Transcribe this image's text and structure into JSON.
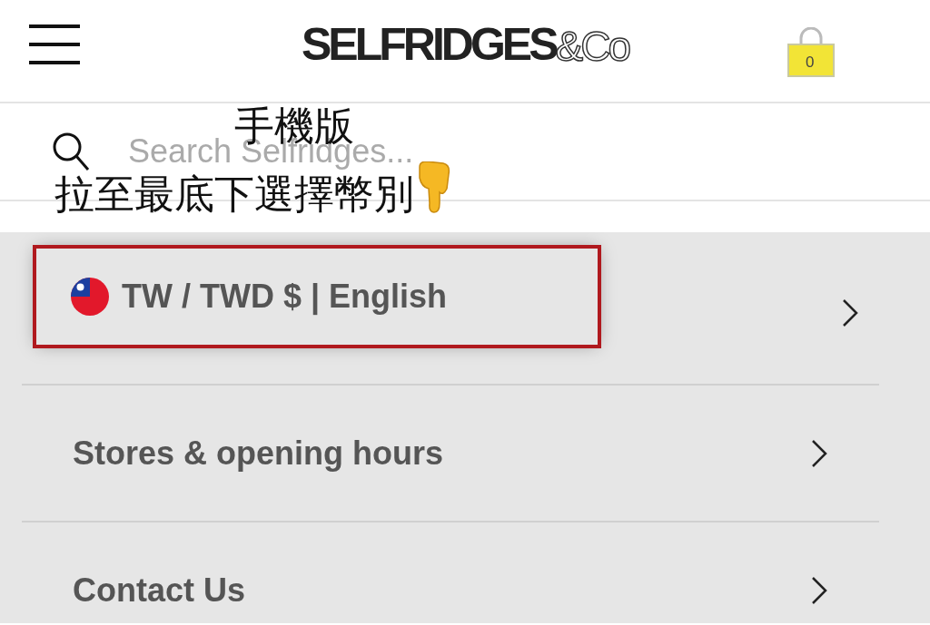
{
  "header": {
    "logo": {
      "main": "SELFRIDGES",
      "suffix": "&Co"
    },
    "bag_count": "0"
  },
  "search": {
    "placeholder": "Search Selfridges..."
  },
  "annotation": {
    "lines": [
      "手機版",
      "拉至最底下選擇幣別"
    ]
  },
  "menu": [
    {
      "kind": "locale",
      "label": "TW / TWD $ | English",
      "highlighted": true
    },
    {
      "kind": "link",
      "label": "Stores & opening hours",
      "highlighted": false
    },
    {
      "kind": "link",
      "label": "Contact Us",
      "highlighted": false
    }
  ]
}
